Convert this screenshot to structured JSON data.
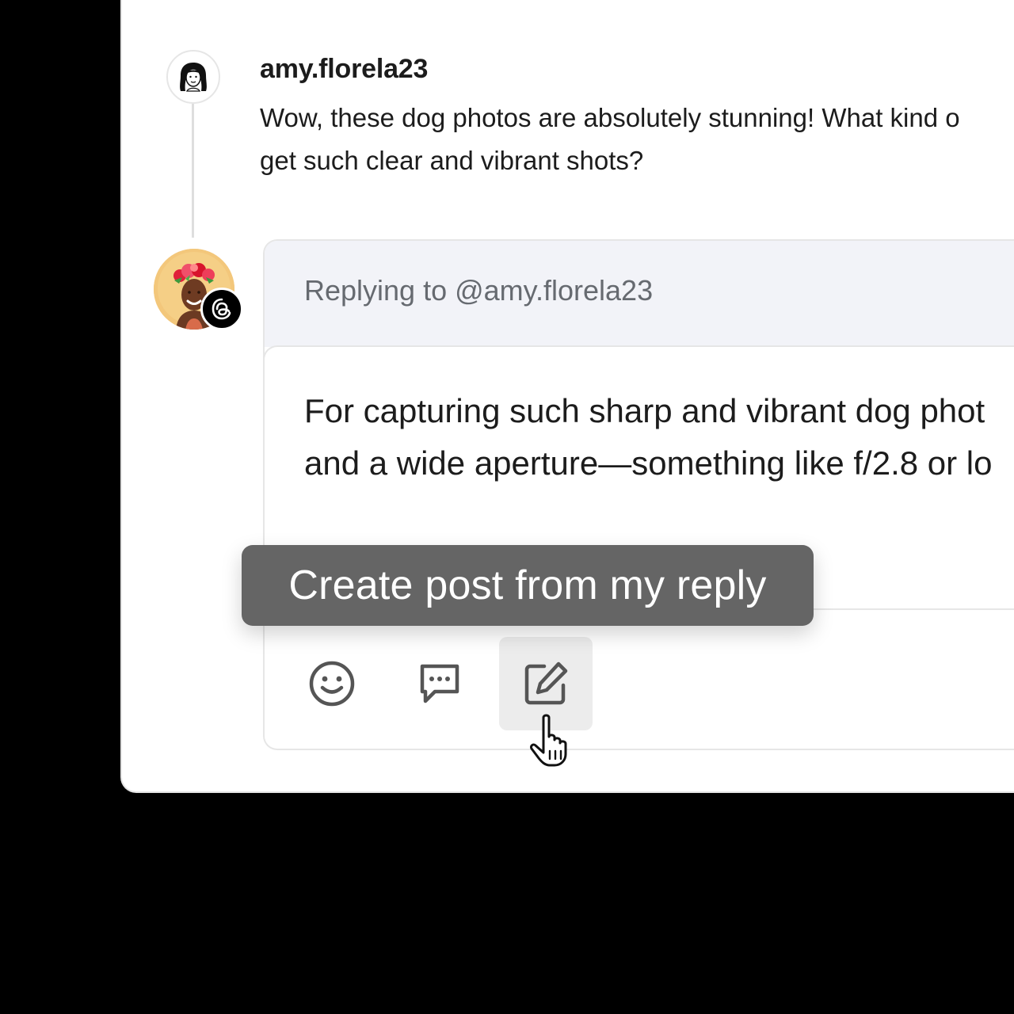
{
  "thread": {
    "original_comment": {
      "username": "amy.florela23",
      "avatar_icon": "illustrated-woman-avatar-icon",
      "text_line1": "Wow, these dog photos are absolutely stunning! What kind o",
      "text_line2": "get such clear and vibrant shots?"
    }
  },
  "reply": {
    "avatar_icon": "user-photo-avatar",
    "platform_badge_icon": "threads-logo-icon",
    "replying_to": "Replying to @amy.florela23",
    "text_line1": "For capturing such sharp and vibrant dog phot",
    "text_line2": "and a wide aperture—something like f/2.8 or lo"
  },
  "toolbar": {
    "actions": [
      {
        "icon": "emoji-icon",
        "active": false
      },
      {
        "icon": "message-dots-icon",
        "active": false
      },
      {
        "icon": "edit-post-icon",
        "active": true
      }
    ]
  },
  "tooltip": {
    "label": "Create post from my reply"
  },
  "colors": {
    "background": "#000000",
    "panel": "#ffffff",
    "header_tint": "#f2f3f8",
    "tooltip_bg": "#656565",
    "active_button_bg": "#ececec",
    "text_primary": "#1c1c1c",
    "text_secondary": "#666a70"
  }
}
